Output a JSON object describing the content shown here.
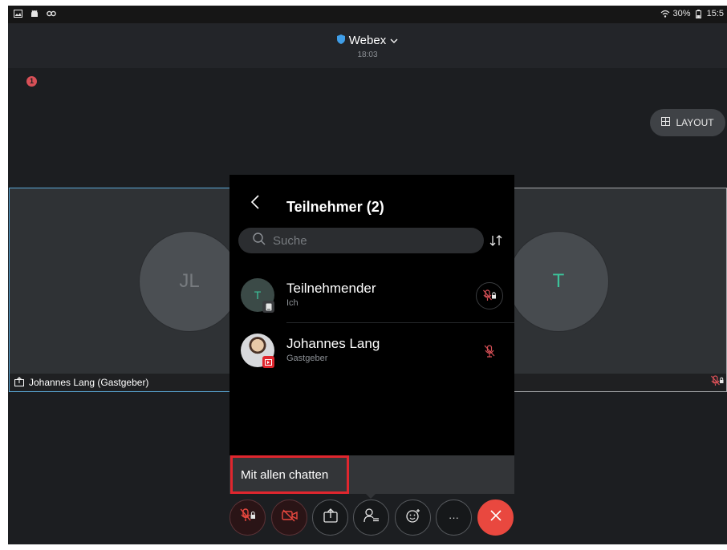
{
  "status_bar": {
    "battery": "30%",
    "time": "15:5"
  },
  "header": {
    "app_name": "Webex",
    "time": "18:03"
  },
  "alert_badge": "1",
  "layout_button": {
    "label": "LAYOUT",
    "icon": "grid-icon"
  },
  "tiles": [
    {
      "initials": "JL",
      "label": "Johannes Lang (Gastgeber)",
      "icon": "share-icon"
    },
    {
      "initials": "T",
      "icon": "mic-muted-lock-icon"
    }
  ],
  "panel": {
    "title": "Teilnehmer (2)",
    "search_placeholder": "Suche",
    "participants": [
      {
        "initials": "T",
        "name": "Teilnehmender",
        "role": "Ich",
        "device_icon": "tablet-icon",
        "mic_icon": "mic-muted-lock-icon"
      },
      {
        "name": "Johannes Lang",
        "role": "Gastgeber",
        "device_icon": "presenting-icon",
        "mic_icon": "mic-muted-icon"
      }
    ]
  },
  "chat": {
    "label": "Mit allen chatten"
  },
  "controls": [
    {
      "icon": "mic-muted-lock-icon"
    },
    {
      "icon": "video-off-icon"
    },
    {
      "icon": "share-icon"
    },
    {
      "icon": "participants-icon"
    },
    {
      "icon": "reaction-icon"
    },
    {
      "icon": "more-icon",
      "label": "···"
    },
    {
      "icon": "end-call-icon"
    }
  ],
  "colors": {
    "accent_green": "#3cc29a",
    "muted_red": "#d85057",
    "end_call": "#e9483f",
    "highlight_box": "#e0262e",
    "tile_border": "#5aa9d8"
  }
}
